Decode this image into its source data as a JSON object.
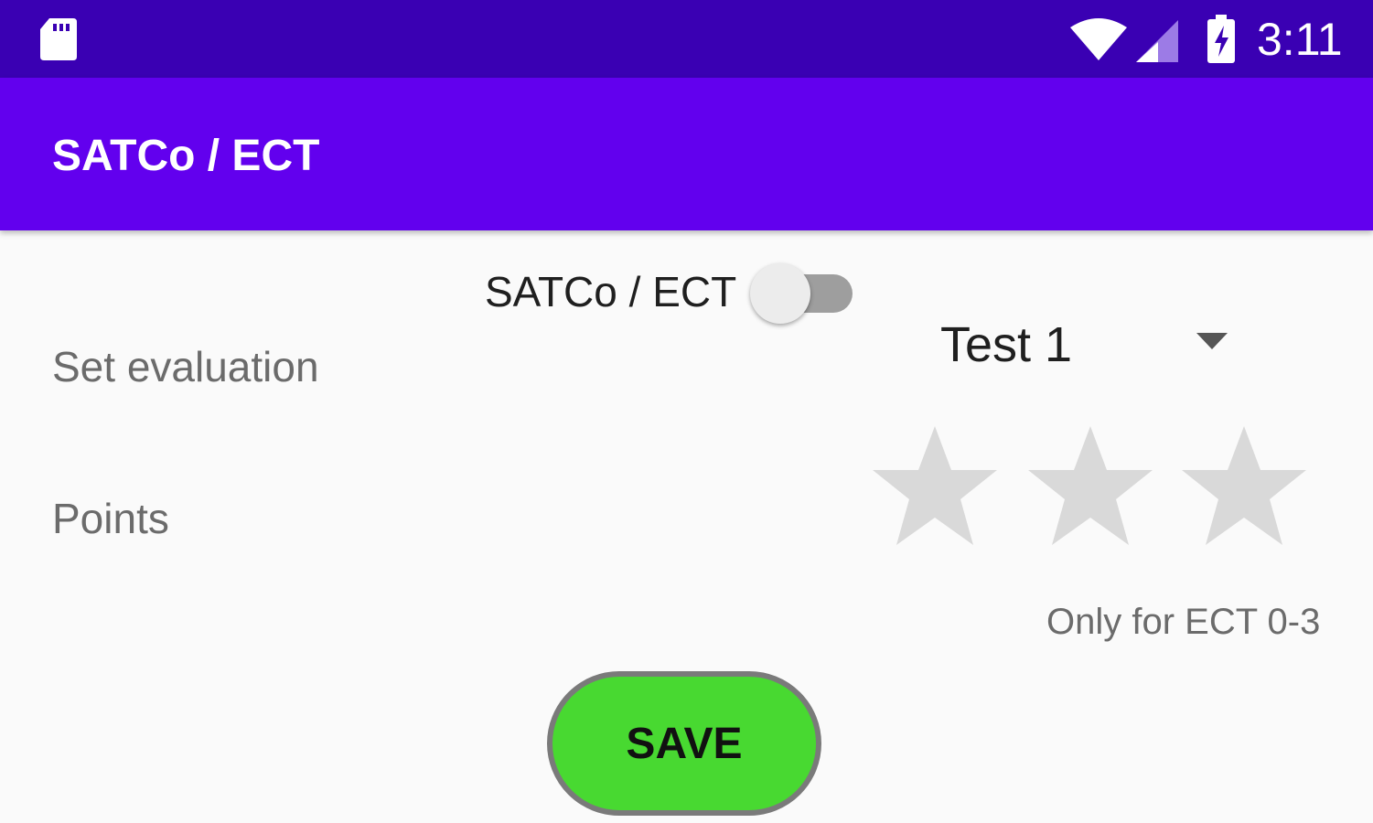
{
  "status_bar": {
    "time": "3:11",
    "icons": [
      "sd-card-icon",
      "wifi-icon",
      "cell-signal-icon",
      "battery-charging-icon"
    ],
    "background": "#3a00b3"
  },
  "app_bar": {
    "title": "SATCo / ECT",
    "background": "#6200ee"
  },
  "form": {
    "switch_label": "SATCo / ECT",
    "switch_on": false,
    "evaluation_label": "Set evaluation",
    "evaluation_selected": "Test 1",
    "points_label": "Points",
    "rating": {
      "value": 0,
      "max": 3
    },
    "hint": "Only for ECT 0-3",
    "save_label": "SAVE",
    "save_color": "#48d931"
  }
}
